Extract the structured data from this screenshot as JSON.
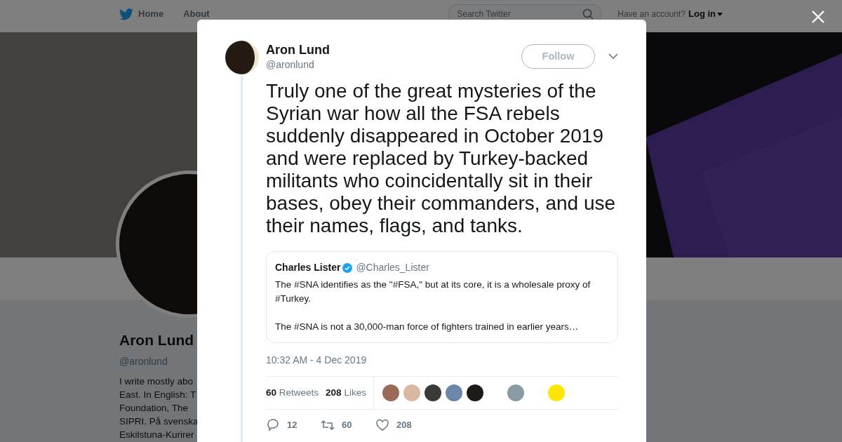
{
  "background_page": {
    "nav": {
      "items": [
        {
          "label": "Home"
        },
        {
          "label": "About"
        }
      ],
      "search": {
        "placeholder": "Search Twitter"
      },
      "account_prompt": "Have an account?",
      "login": "Log in"
    },
    "profile": {
      "name": "Aron Lund",
      "handle": "@aronlund",
      "bio_lines": [
        "I write mostly abo",
        "East. In English: T",
        "Foundation, The",
        "SIPRI. På svenska",
        "Eskilstuna-Kurirer"
      ]
    }
  },
  "tweet": {
    "author": {
      "name": "Aron Lund",
      "handle": "@aronlund"
    },
    "follow_button": "Follow",
    "text": "Truly one of the great mysteries of the Syrian war how all the FSA rebels suddenly disappeared in October 2019 and were replaced by Turkey-backed militants who coincidentally sit in their bases, obey their commanders, and use their names, flags, and tanks.",
    "quote": {
      "name": "Charles Lister",
      "verified": true,
      "handle": "@Charles_Lister",
      "paragraphs": [
        "The #SNA identifies as the \"#FSA,\" but at its core, it is a wholesale proxy of #Turkey.",
        "The #SNA is not a 30,000-man force of fighters trained in earlier years…"
      ]
    },
    "timestamp": "10:32 AM - 4 Dec 2019",
    "stats": [
      {
        "count": "60",
        "label": "Retweets"
      },
      {
        "count": "208",
        "label": "Likes"
      }
    ],
    "likers": [
      {
        "color": "#9a6a5a"
      },
      {
        "color": "#d8b8a0"
      },
      {
        "color": "#3a3a38"
      },
      {
        "color": "#6a86a8"
      },
      {
        "color": "#1e1a16"
      },
      {
        "color": "#8a9aa4"
      },
      {
        "color": "#ffe600"
      }
    ],
    "actions": [
      {
        "kind": "reply",
        "count": "12"
      },
      {
        "kind": "retweet",
        "count": "60"
      },
      {
        "kind": "like",
        "count": "208"
      }
    ]
  }
}
